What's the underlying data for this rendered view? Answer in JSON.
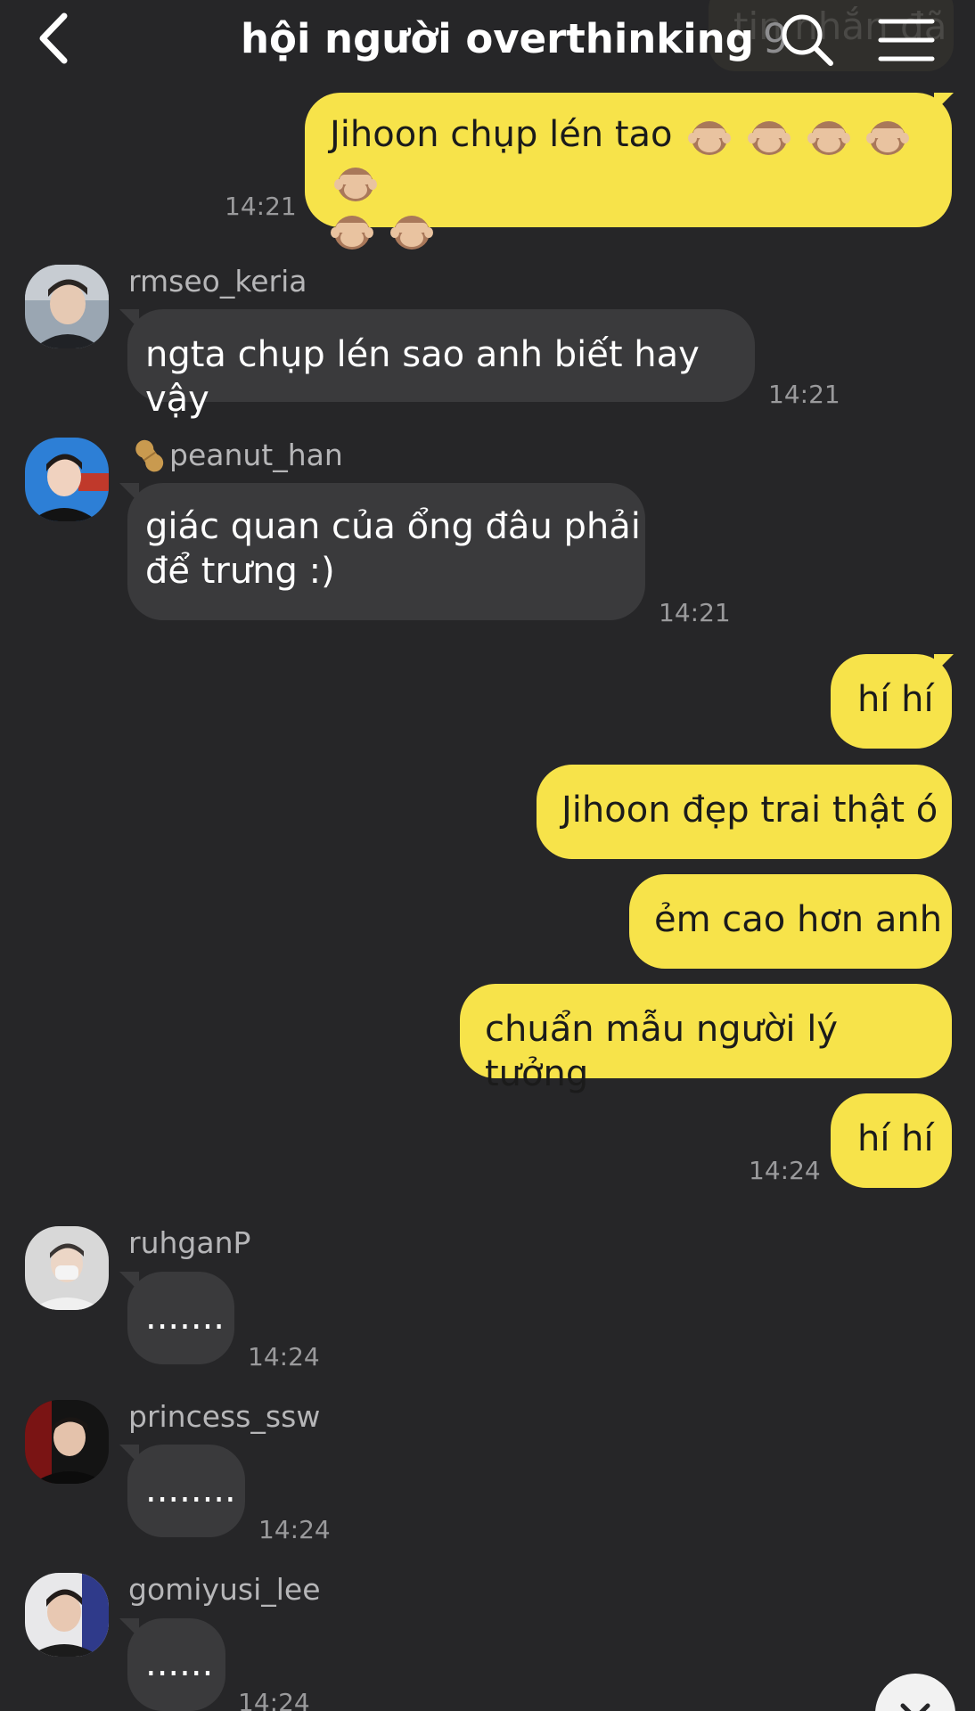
{
  "header": {
    "title": "hội người overthinking",
    "member_count": "9",
    "ghost_text": "tin nhắn đã"
  },
  "messages": [
    {
      "side": "me",
      "text": "Jihoon chụp lén tao",
      "emoji": [
        "🙈",
        "🙈",
        "🙈",
        "🙈",
        "🙈",
        "🙈",
        "🙈"
      ],
      "time": "14:21"
    },
    {
      "side": "them",
      "sender": "rmseo_keria",
      "text": "ngta chụp lén sao anh biết hay vậy",
      "time": "14:21"
    },
    {
      "side": "them",
      "sender": "peanut_han",
      "sender_icon": "peanut-icon",
      "text_lines": [
        "giác quan của ổng đâu phải",
        "để trưng :)"
      ],
      "time": "14:21"
    },
    {
      "side": "me",
      "text": "hí hí"
    },
    {
      "side": "me",
      "text": "Jihoon đẹp trai thật ó"
    },
    {
      "side": "me",
      "text": "ẻm cao hơn anh"
    },
    {
      "side": "me",
      "text": "chuẩn mẫu người lý tưởng"
    },
    {
      "side": "me",
      "text": "hí hí",
      "time": "14:24"
    },
    {
      "side": "them",
      "sender": "ruhganP",
      "text": ".......",
      "time": "14:24"
    },
    {
      "side": "them",
      "sender": "princess_ssw",
      "text": "........",
      "time": "14:24"
    },
    {
      "side": "them",
      "sender": "gomiyusi_lee",
      "text": "......",
      "time": "14:24"
    }
  ],
  "icons": {
    "back": "chevron-left-icon",
    "search": "search-icon",
    "menu": "hamburger-menu-icon",
    "scroll_down": "chevron-down-icon",
    "emoji": "see-no-evil-monkey-icon"
  },
  "colors": {
    "background": "#262628",
    "my_bubble": "#f7e34a",
    "their_bubble": "#3a3a3c",
    "timestamp": "#9a9a9c"
  }
}
